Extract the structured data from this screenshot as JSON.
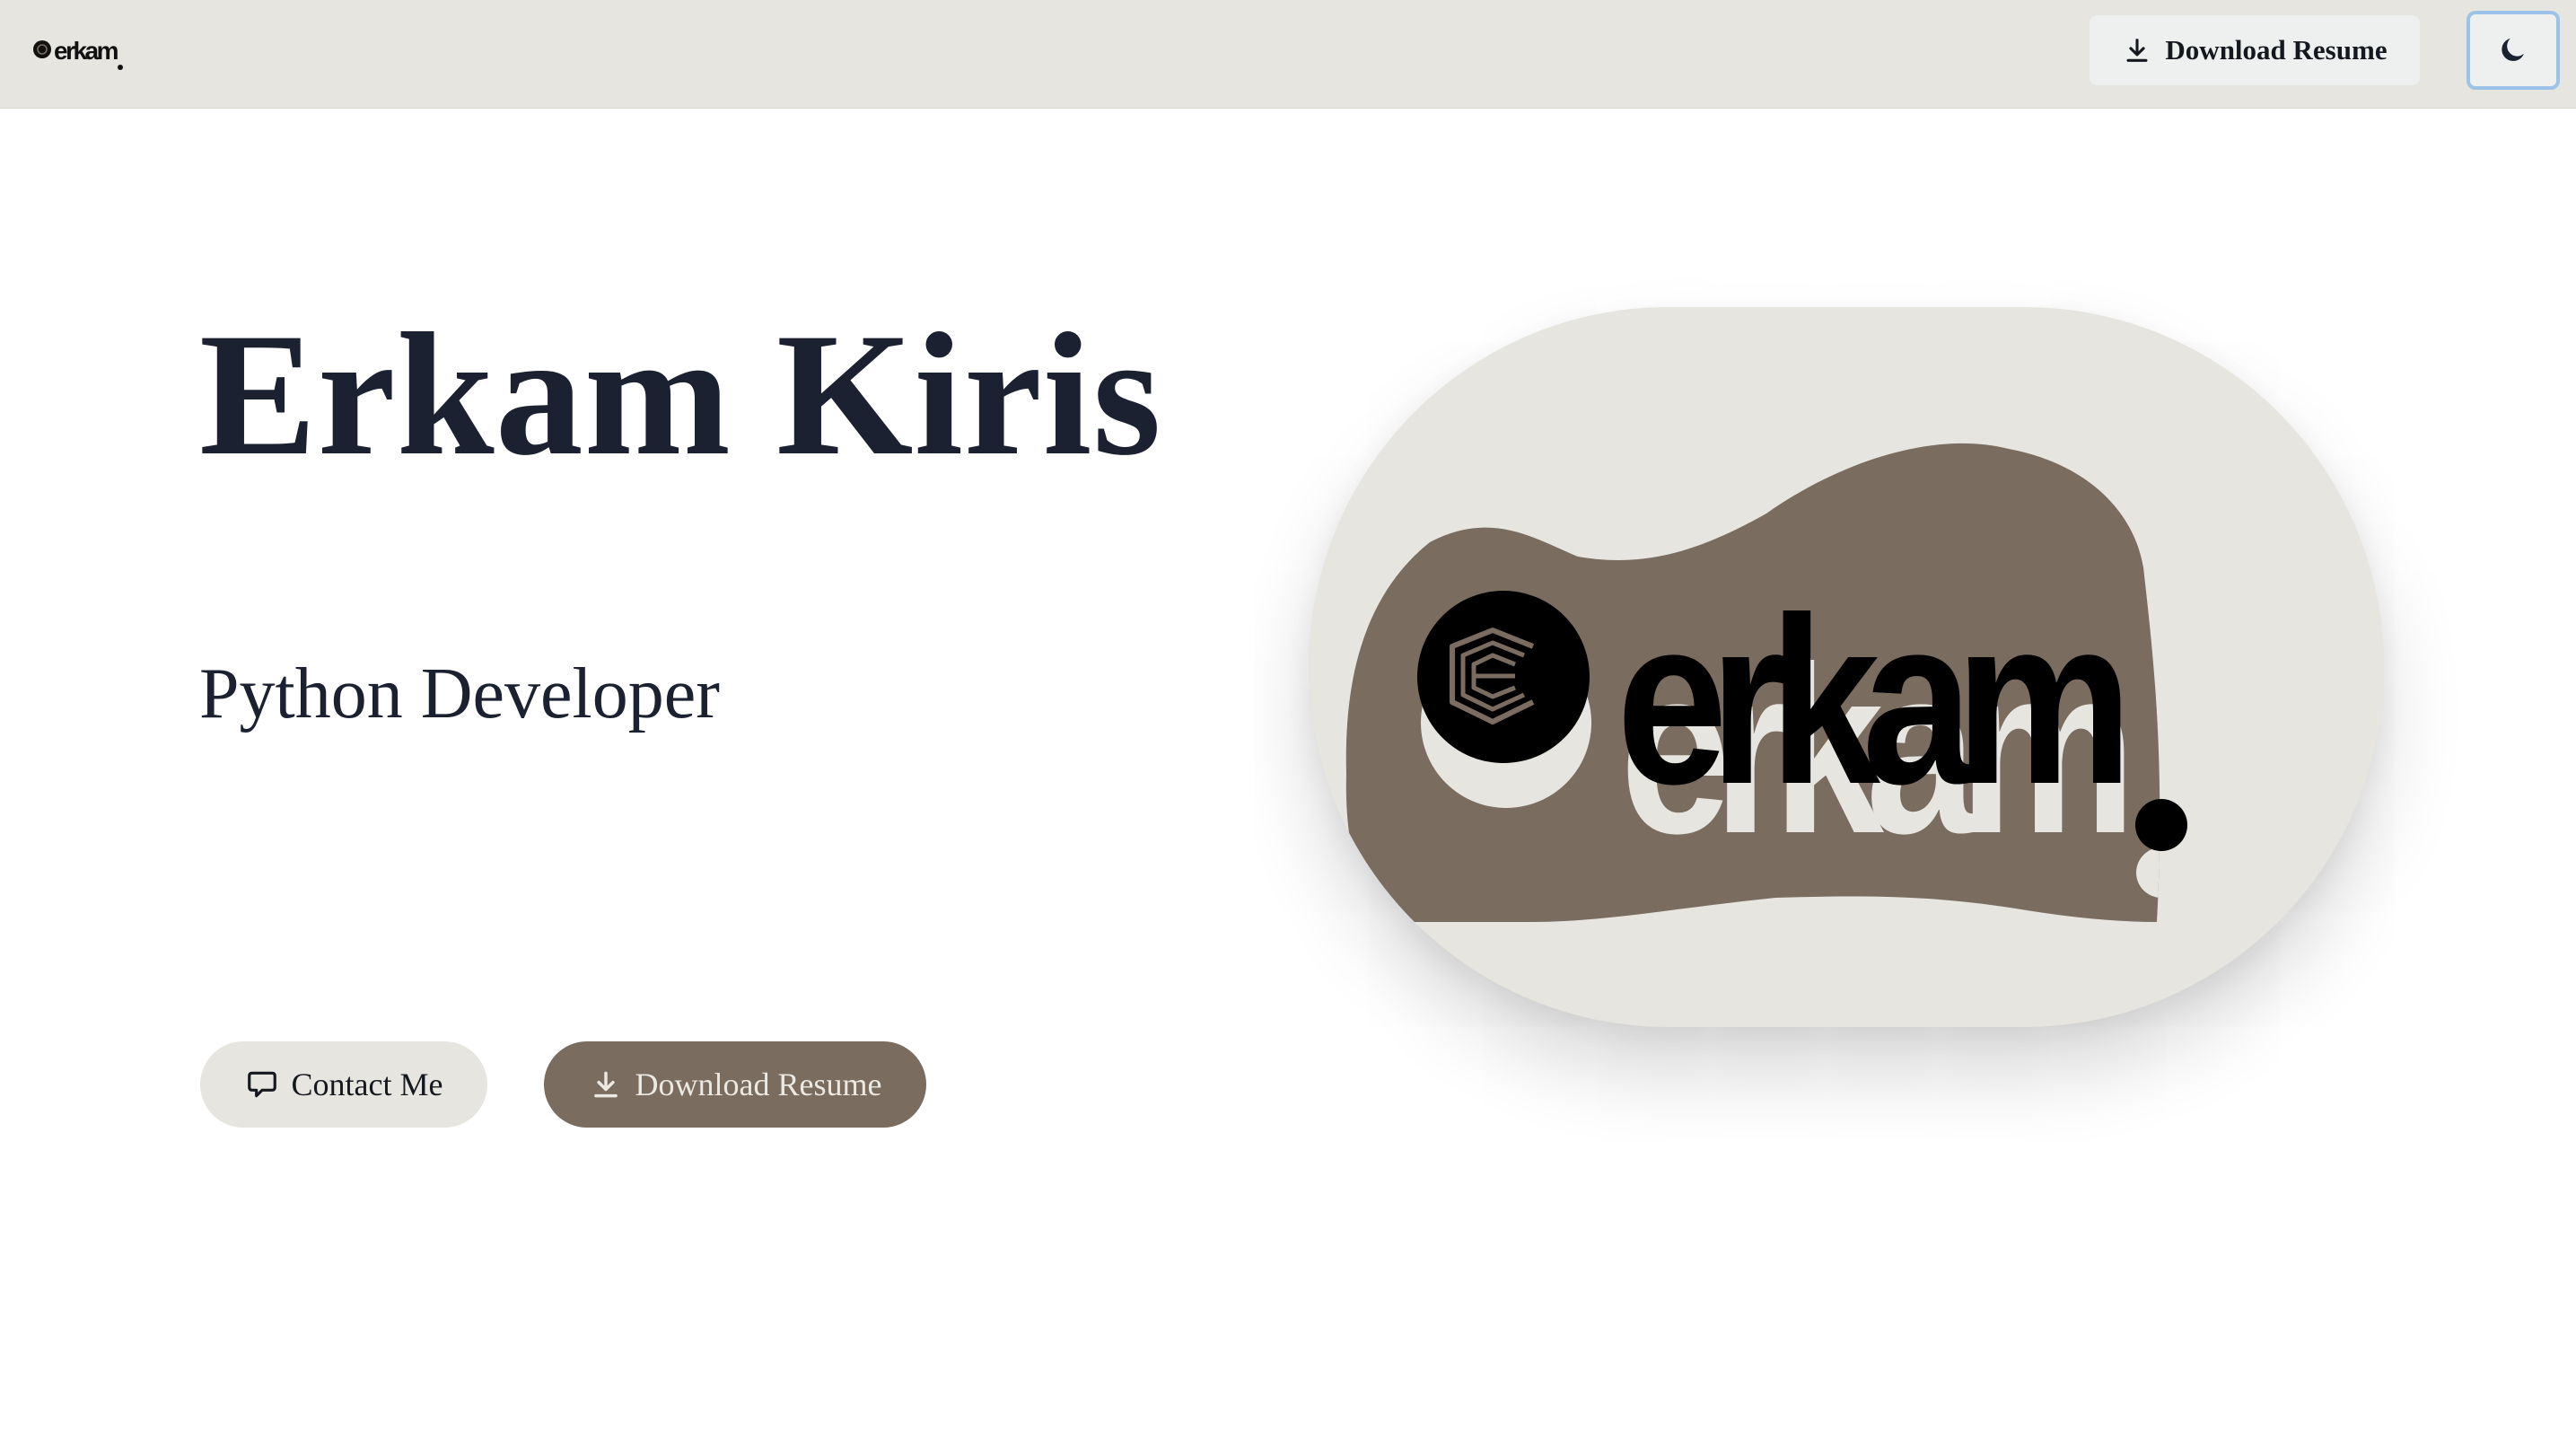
{
  "nav": {
    "logo_text": "erkam",
    "download_label": "Download Resume",
    "download_icon": "download-icon",
    "theme_icon": "moon-icon"
  },
  "hero": {
    "name": "Erkam Kiris",
    "role": "Python Developer",
    "contact_label": "Contact Me",
    "contact_icon": "chat-bubble-icon",
    "download_label": "Download Resume",
    "download_icon": "download-icon"
  },
  "logo": {
    "wordmark": "erkam",
    "emblem_icon": "e-emblem-icon"
  },
  "colors": {
    "nav_bg": "#e6e5df",
    "text_dark": "#1b2130",
    "accent_brown": "#7a6c5f",
    "pill_light": "#e6e5df",
    "toggle_border": "#9cc3e8"
  }
}
